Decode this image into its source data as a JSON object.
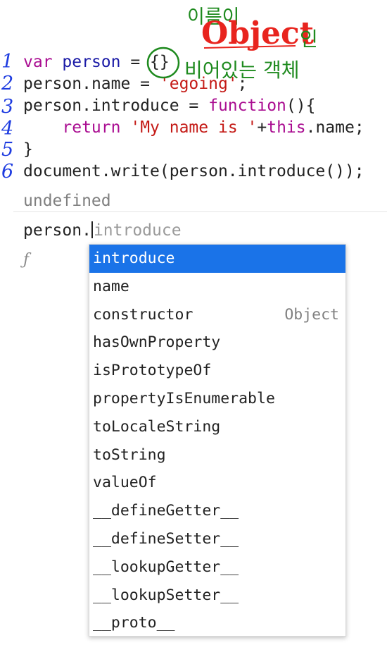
{
  "code": {
    "line1": {
      "kw": "var",
      "name": "person",
      "op": " = ",
      "value": "{}"
    },
    "line2": {
      "obj": "person",
      "prop": ".name = ",
      "str": "'egoing'",
      "end": ";"
    },
    "line3": {
      "obj": "person",
      "prop": ".introduce = ",
      "kw": "function",
      "end": "(){"
    },
    "line4": {
      "indent": "    ",
      "kw": "return",
      "str": "'My name is '",
      "op": "+",
      "this": "this",
      "end": ".name;"
    },
    "line5": {
      "text": "}"
    },
    "line6": {
      "text": "document.write(person.introduce());"
    }
  },
  "console": {
    "result": "undefined",
    "input_typed": "person.",
    "input_suggestion": "introduce",
    "function_glyph": "ƒ"
  },
  "autocomplete": {
    "items": [
      {
        "label": "introduce",
        "hint": "",
        "selected": true
      },
      {
        "label": "name",
        "hint": "",
        "selected": false
      },
      {
        "label": "constructor",
        "hint": "Object",
        "selected": false
      },
      {
        "label": "hasOwnProperty",
        "hint": "",
        "selected": false
      },
      {
        "label": "isPrototypeOf",
        "hint": "",
        "selected": false
      },
      {
        "label": "propertyIsEnumerable",
        "hint": "",
        "selected": false
      },
      {
        "label": "toLocaleString",
        "hint": "",
        "selected": false
      },
      {
        "label": "toString",
        "hint": "",
        "selected": false
      },
      {
        "label": "valueOf",
        "hint": "",
        "selected": false
      },
      {
        "label": "__defineGetter__",
        "hint": "",
        "selected": false
      },
      {
        "label": "__defineSetter__",
        "hint": "",
        "selected": false
      },
      {
        "label": "__lookupGetter__",
        "hint": "",
        "selected": false
      },
      {
        "label": "__lookupSetter__",
        "hint": "",
        "selected": false
      },
      {
        "label": "__proto__",
        "hint": "",
        "selected": false
      }
    ]
  },
  "annotations": {
    "line_numbers": [
      "1",
      "2",
      "3",
      "4",
      "5",
      "6"
    ],
    "top_text": "이름이",
    "object_word": "Object",
    "in_text": "인",
    "bottom_text": "비어있는 객체",
    "colors": {
      "numbers": "#1e3ce0",
      "green": "#1e8a1e",
      "red": "#e8241e"
    }
  }
}
